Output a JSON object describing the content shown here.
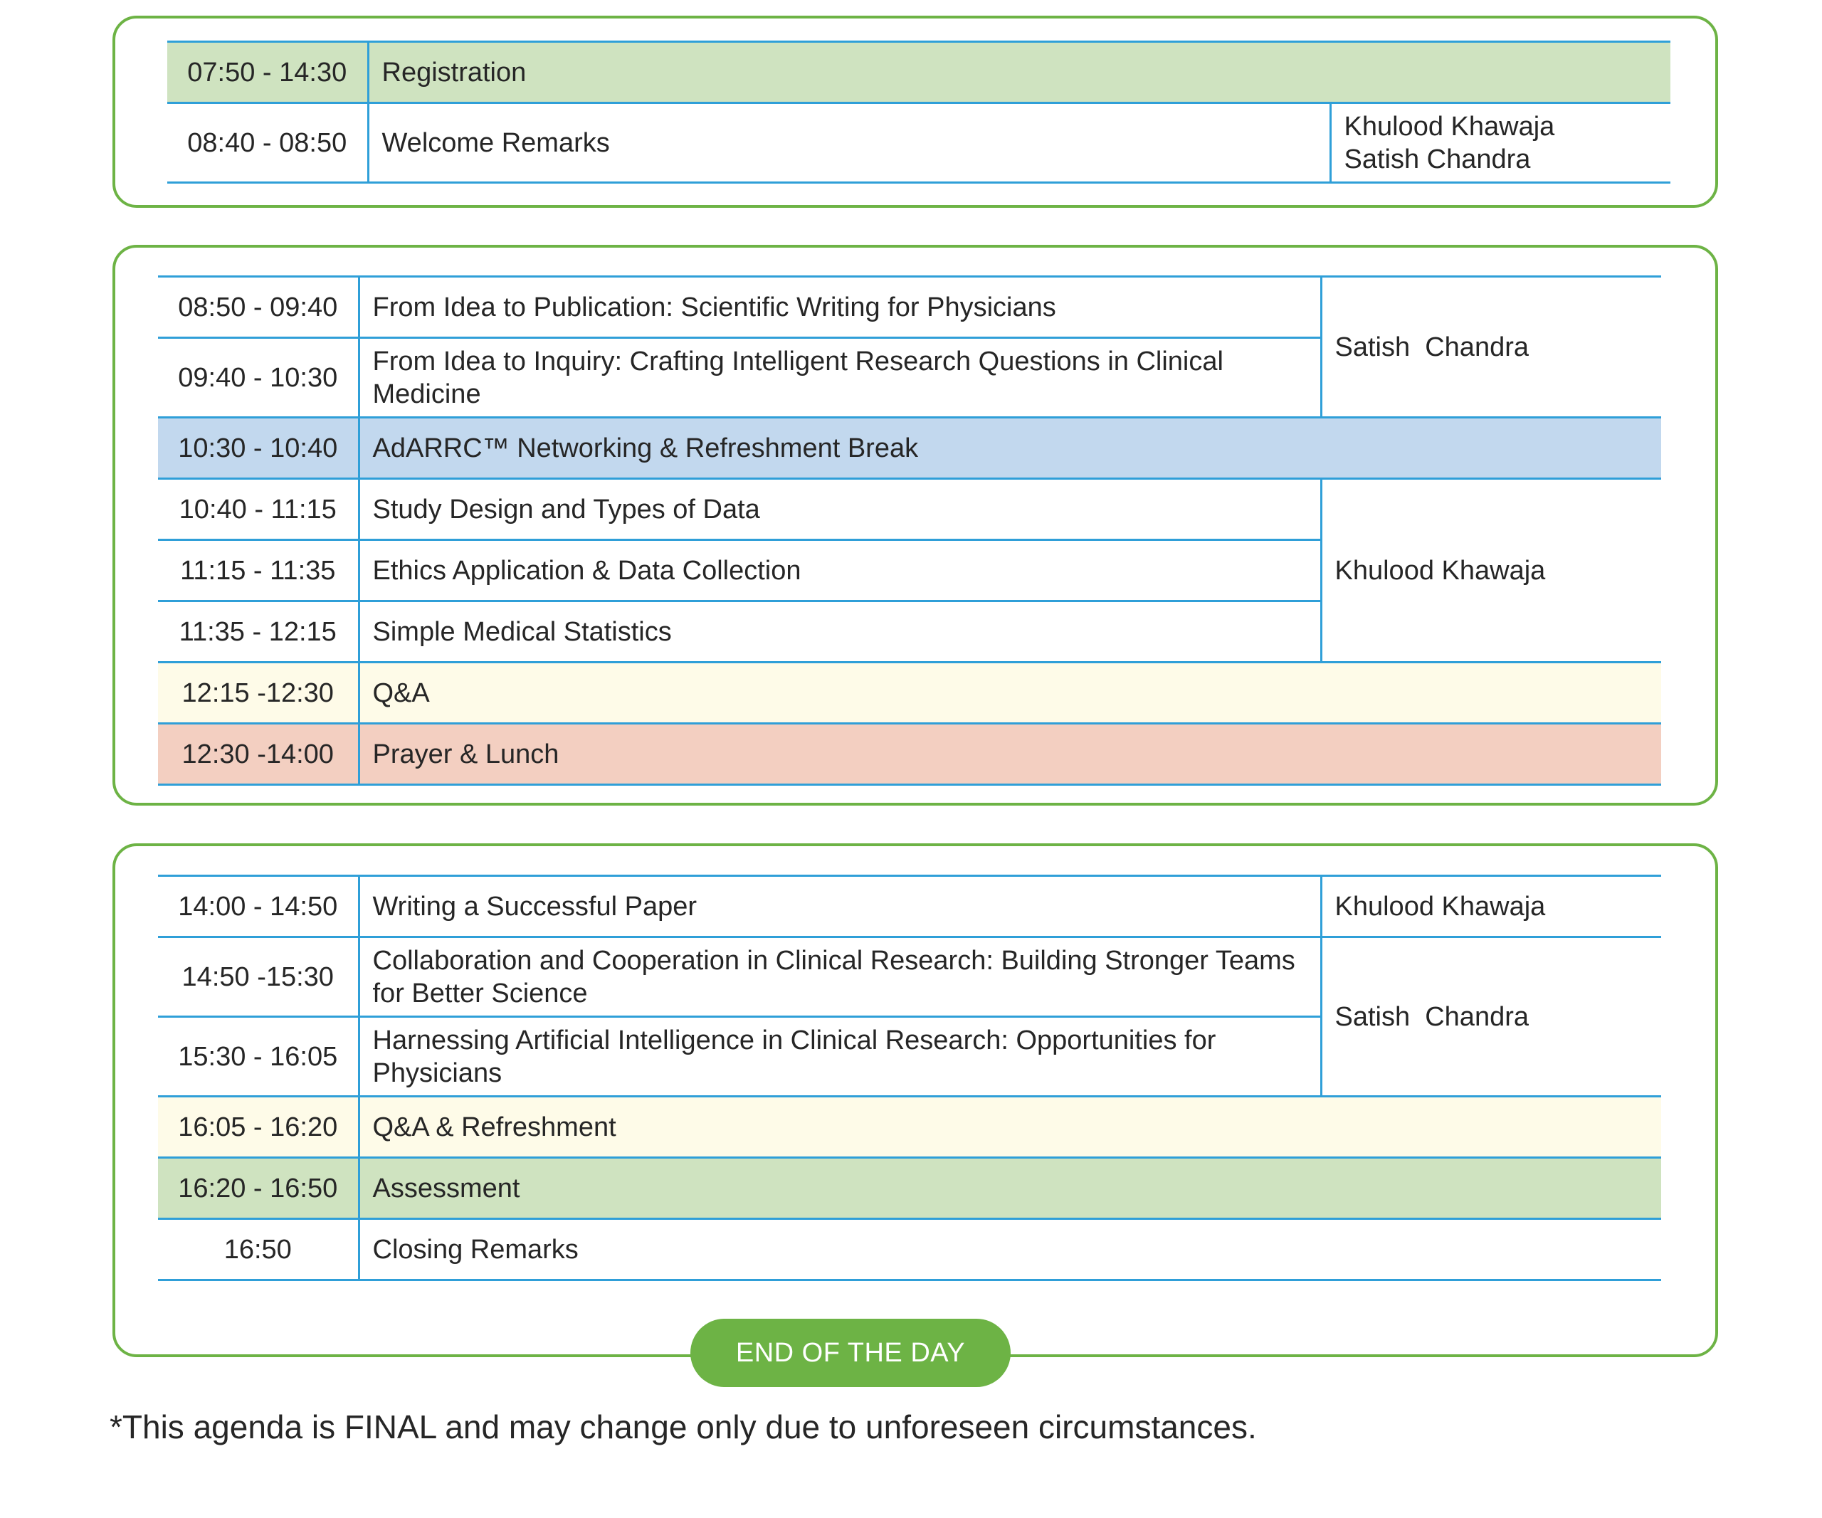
{
  "session1": {
    "rows": [
      {
        "time": "07:50 - 14:30",
        "title": "Registration",
        "speaker": ""
      },
      {
        "time": "08:40 - 08:50",
        "title": "Welcome Remarks",
        "speaker": "Khulood Khawaja\nSatish Chandra"
      }
    ]
  },
  "session2": {
    "rows": [
      {
        "time": "08:50 - 09:40",
        "title": "From Idea to Publication: Scientific Writing for Physicians"
      },
      {
        "time": "09:40 - 10:30",
        "title": "From Idea to Inquiry: Crafting Intelligent Research Questions in Clinical Medicine"
      },
      {
        "time": "10:30 - 10:40",
        "title": "AdARRC™ Networking & Refreshment Break"
      },
      {
        "time": "10:40 - 11:15",
        "title": "Study Design and Types of Data"
      },
      {
        "time": "11:15 - 11:35",
        "title": "Ethics Application & Data Collection"
      },
      {
        "time": "11:35 - 12:15",
        "title": "Simple Medical Statistics"
      },
      {
        "time": "12:15 -12:30",
        "title": "Q&A"
      },
      {
        "time": "12:30 -14:00",
        "title": "Prayer & Lunch"
      }
    ],
    "speakers": [
      "Satish  Chandra",
      "Khulood Khawaja"
    ]
  },
  "session3": {
    "rows": [
      {
        "time": "14:00 - 14:50",
        "title": "Writing a Successful Paper"
      },
      {
        "time": "14:50 -15:30",
        "title": "Collaboration and Cooperation in Clinical Research: Building Stronger Teams for Better Science"
      },
      {
        "time": "15:30 - 16:05",
        "title": "Harnessing Artificial Intelligence in Clinical Research: Opportunities for Physicians"
      },
      {
        "time": "16:05 - 16:20",
        "title": "Q&A & Refreshment"
      },
      {
        "time": "16:20 - 16:50",
        "title": "Assessment"
      },
      {
        "time": "16:50",
        "title": "Closing Remarks"
      }
    ],
    "speakers": [
      "Khulood Khawaja",
      "Satish  Chandra"
    ]
  },
  "end_label": "END OF THE DAY",
  "footnote": "*This agenda is FINAL and may change only due to unforeseen circumstances.",
  "colors": {
    "panel_border": "#6db345",
    "table_line": "#2f9fd8",
    "row_green": "#cfe3c0",
    "row_blue": "#c2d8ee",
    "row_yellow": "#fefbe8",
    "row_peach": "#f3cfc1"
  }
}
